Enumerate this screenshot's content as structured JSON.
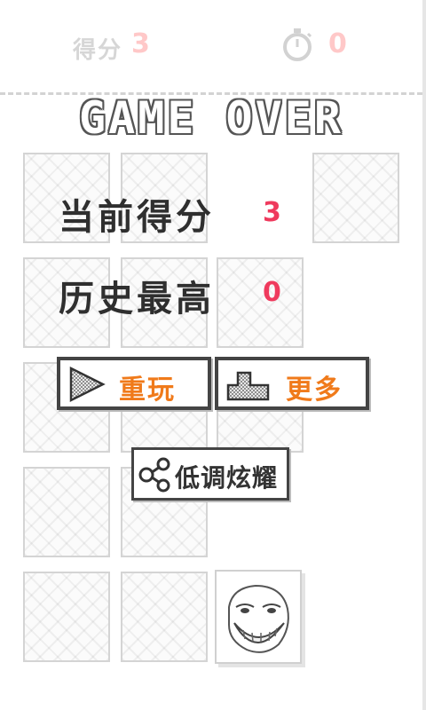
{
  "header": {
    "score_label": "得分",
    "score_value": "3",
    "time_icon": "stopwatch-icon",
    "time_value": "0"
  },
  "title": "GAME OVER",
  "results": {
    "current_label": "当前得分",
    "current_value": "3",
    "best_label": "历史最高",
    "best_value": "0"
  },
  "buttons": {
    "replay_icon": "play-icon",
    "replay_label": "重玩",
    "more_icon": "blocks-icon",
    "more_label": "更多",
    "share_icon": "share-icon",
    "share_label": "低调炫耀"
  },
  "board": {
    "troll_icon": "troll-face-icon"
  },
  "colors": {
    "accent_orange": "#f07a1a",
    "value_red": "#ef3a5d",
    "header_value_pink": "#ffc8c8"
  }
}
